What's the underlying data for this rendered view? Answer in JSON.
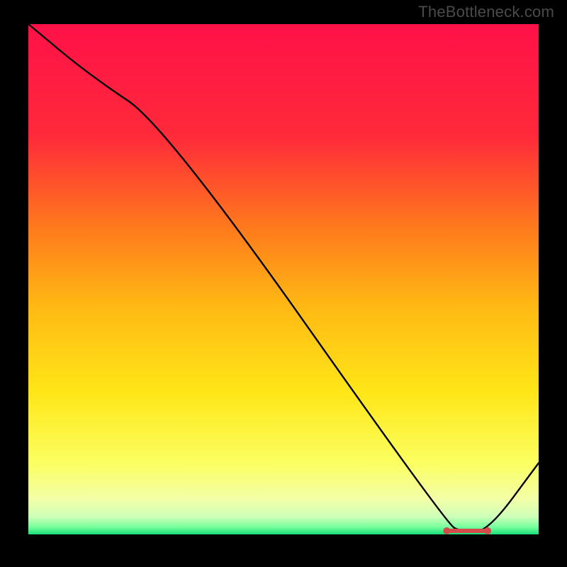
{
  "watermark": "TheBottleneck.com",
  "chart_data": {
    "type": "line",
    "title": "",
    "xlabel": "",
    "ylabel": "",
    "xlim": [
      0,
      100
    ],
    "ylim": [
      0,
      100
    ],
    "x": [
      0,
      12,
      27,
      82,
      85,
      90,
      100
    ],
    "values": [
      100,
      90,
      80,
      2,
      0.5,
      0.5,
      14
    ],
    "optimum_band": {
      "x_start": 82,
      "x_end": 90,
      "y": 0.7
    },
    "gradient_stops": [
      {
        "pos": 0.0,
        "color": "#ff1148"
      },
      {
        "pos": 0.22,
        "color": "#ff2a3a"
      },
      {
        "pos": 0.4,
        "color": "#ff7a1c"
      },
      {
        "pos": 0.55,
        "color": "#ffb814"
      },
      {
        "pos": 0.72,
        "color": "#ffe617"
      },
      {
        "pos": 0.86,
        "color": "#fbff60"
      },
      {
        "pos": 0.93,
        "color": "#f4ffa6"
      },
      {
        "pos": 0.965,
        "color": "#cfffb8"
      },
      {
        "pos": 0.985,
        "color": "#7aff9e"
      },
      {
        "pos": 1.0,
        "color": "#17e07a"
      }
    ]
  }
}
